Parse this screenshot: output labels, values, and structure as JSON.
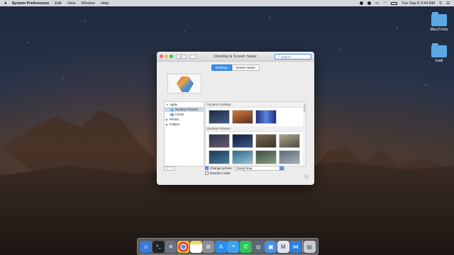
{
  "menubar": {
    "app_name": "System Preferences",
    "items": [
      "Edit",
      "View",
      "Window",
      "Help"
    ],
    "clock": "Tue Sep 8  3:44 AM"
  },
  "desktop_icons": [
    {
      "label": "MacsTricks"
    },
    {
      "label": "mudi"
    }
  ],
  "window": {
    "title": "Desktop & Screen Saver",
    "search_placeholder": "Search",
    "tabs": [
      {
        "label": "Desktop",
        "active": true
      },
      {
        "label": "Screen Saver",
        "active": false
      }
    ],
    "sidebar": [
      {
        "label": "Apple",
        "type": "group"
      },
      {
        "label": "Desktop Pictures",
        "type": "item",
        "selected": true
      },
      {
        "label": "Colors",
        "type": "item"
      },
      {
        "label": "Photos",
        "type": "group"
      },
      {
        "label": "Folders",
        "type": "group"
      }
    ],
    "sections": [
      {
        "title": "Dynamic Desktop",
        "thumbs": [
          "#2b3a55",
          "#c0603a",
          "#2f56b0"
        ]
      },
      {
        "title": "Desktop Pictures",
        "thumbs": [
          "#3a4a6a",
          "#1f3356",
          "#6b5a4a",
          "#8a8070",
          "#2b4b6a",
          "#355f7a",
          "#4a6b5a",
          "#6a7a8a"
        ]
      }
    ],
    "options": {
      "change_picture_label": "Change picture:",
      "change_picture_checked": true,
      "interval": "Every hour",
      "random_label": "Random order",
      "random_checked": false
    },
    "help": "?"
  },
  "dock": [
    {
      "name": "finder",
      "color": "#3a7bd5",
      "glyph": "☺"
    },
    {
      "name": "terminal",
      "color": "#222",
      "glyph": ">_"
    },
    {
      "name": "launchpad",
      "color": "#6b7380",
      "glyph": "🚀"
    },
    {
      "name": "chrome",
      "color": "#e5e5e5",
      "glyph": "◉"
    },
    {
      "name": "notes",
      "color": "#f6d55c",
      "glyph": ""
    },
    {
      "name": "system-preferences",
      "color": "#8a8f98",
      "glyph": "⚙"
    },
    {
      "name": "app-store",
      "color": "#2a8cf0",
      "glyph": "A"
    },
    {
      "name": "safari",
      "color": "#3aa3f0",
      "glyph": "⌖"
    },
    {
      "name": "whatsapp",
      "color": "#2fc257",
      "glyph": "✆"
    },
    {
      "name": "disk-utility",
      "color": "#5a6a7a",
      "glyph": "◎"
    },
    {
      "name": "preview",
      "color": "#4a90e2",
      "glyph": "▣"
    },
    {
      "name": "macs-fan",
      "color": "#dfe6ef",
      "glyph": "M"
    },
    {
      "name": "vscode",
      "color": "#2f7fd6",
      "glyph": "⋈"
    },
    {
      "name": "trash",
      "color": "#c9ced6",
      "glyph": "🗑"
    }
  ]
}
